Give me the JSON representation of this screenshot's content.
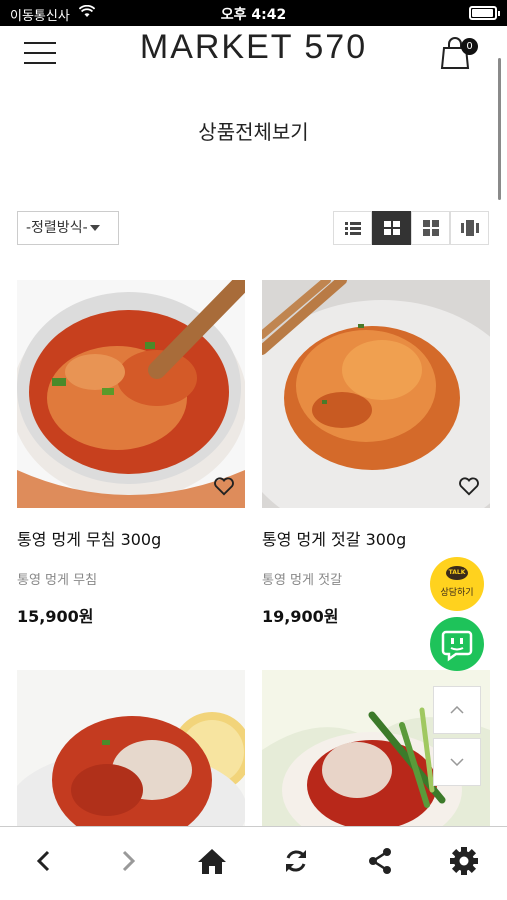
{
  "status_bar": {
    "carrier": "이동통신사",
    "time": "오후 4:42"
  },
  "header": {
    "logo": "MARKET 570",
    "cart_count": "0"
  },
  "page": {
    "title": "상품전체보기"
  },
  "toolbar": {
    "sort_label": "-정렬방식-"
  },
  "products": [
    {
      "name": "통영 멍게 무침 300g",
      "subtitle": "통영 멍게 무침",
      "price": "15,900원"
    },
    {
      "name": "통영 멍게 젓갈 300g",
      "subtitle": "통영 멍게 젓갈",
      "price": "19,900원"
    }
  ],
  "floating": {
    "talk_badge": "TALK",
    "talk_label": "상담하기"
  },
  "colors": {
    "kakao": "#ffd21e",
    "chat_green": "#1ec35a",
    "active_view": "#333333"
  },
  "icons": [
    "menu-icon",
    "cart-icon",
    "list-view-icon",
    "grid-2-icon",
    "grid-small-icon",
    "gallery-view-icon",
    "heart-icon",
    "back-icon",
    "forward-icon",
    "home-icon",
    "refresh-icon",
    "share-icon",
    "settings-icon"
  ]
}
